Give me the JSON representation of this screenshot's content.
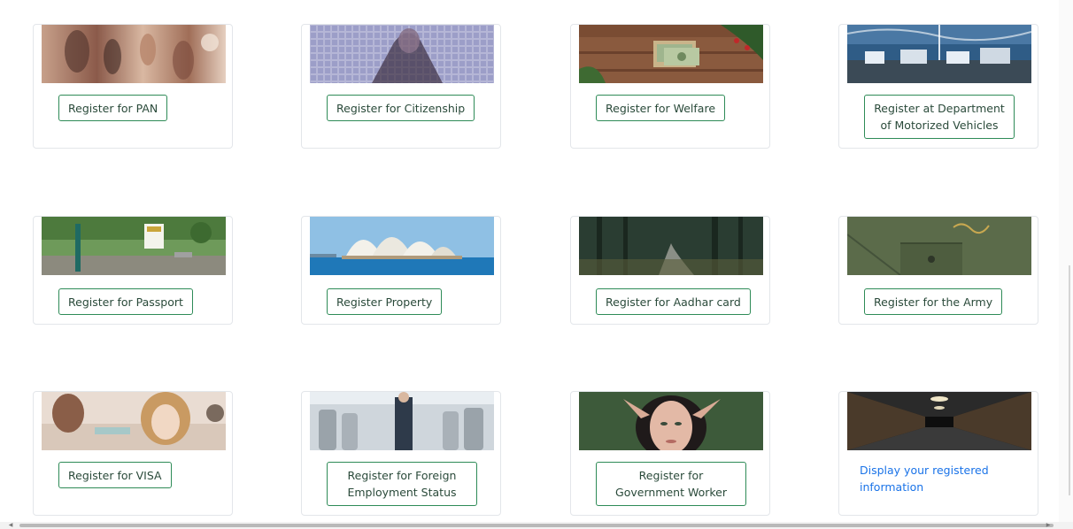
{
  "cards": [
    {
      "label": "Register for PAN",
      "image": "market-crafts-photo"
    },
    {
      "label": "Register for Citizenship",
      "image": "pixel-mosaic-portrait-photo"
    },
    {
      "label": "Register for Welfare",
      "image": "money-gift-photo"
    },
    {
      "label": "Register at Department of Motorized Vehicles",
      "image": "ship-deck-photo"
    },
    {
      "label": "Register for Passport",
      "image": "park-sign-photo"
    },
    {
      "label": "Register Property",
      "image": "sydney-opera-house-photo"
    },
    {
      "label": "Register for Aadhar card",
      "image": "forest-road-photo"
    },
    {
      "label": "Register for the Army",
      "image": "green-jacket-photo"
    },
    {
      "label": "Register for VISA",
      "image": "women-talking-photo"
    },
    {
      "label": "Register for Foreign Employment Status",
      "image": "airplane-cabin-photo"
    },
    {
      "label": "Register for Government Worker",
      "image": "elf-portrait-photo"
    },
    {
      "label": "Display your registered information",
      "image": "dark-corridor-photo"
    }
  ],
  "colors": {
    "button_border": "#2e8b57",
    "button_text": "#2a4a3a",
    "link": "#1a73e8",
    "card_border": "#e3e6ea"
  }
}
